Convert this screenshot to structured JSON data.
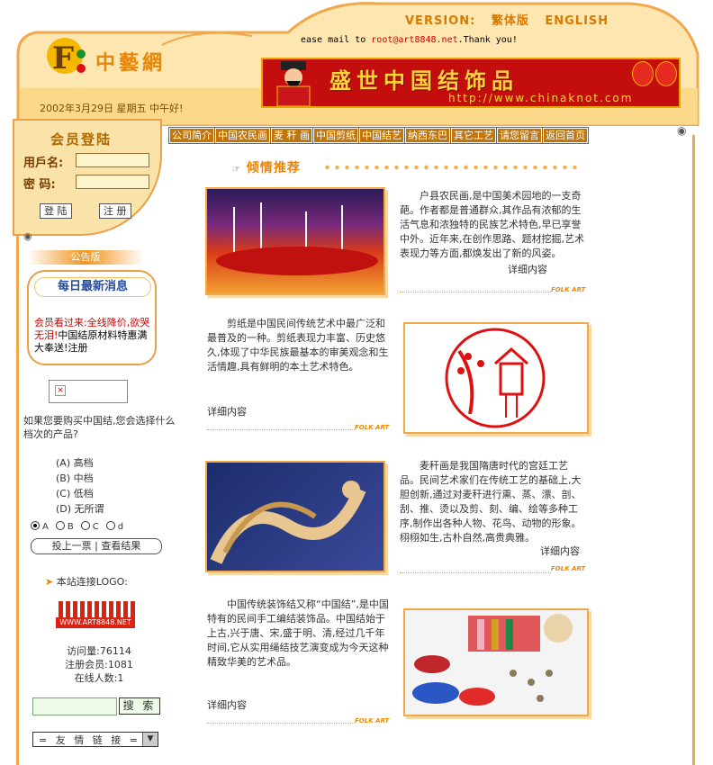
{
  "header": {
    "version_label": "VERSION:",
    "traditional": "繁体版",
    "english": "ENGLISH",
    "scroll_prefix": "ease mail to ",
    "scroll_email": "root@art8848.net",
    "scroll_suffix": ".Thank you!",
    "site_name": "中藝網",
    "date": "2002年3月29日  星期五    中午好!",
    "banner_title": "盛世中国结饰品",
    "banner_url": "http://www.chinaknot.com"
  },
  "nav": [
    "公司简介",
    "中国农民画",
    "麦 秆 画",
    "中国剪纸",
    "中国结艺",
    "纳西东巴",
    "其它工艺",
    "请您留言",
    "返回首页"
  ],
  "login": {
    "title": "会员登陆",
    "user_label": "用戶名:",
    "pass_label": "密  码:",
    "login_btn": "登 陆",
    "register_btn": "注 册"
  },
  "notice": {
    "tab": "公告版",
    "heading": "每日最新消息",
    "text_red": "会员看过来:全线降价,欲哭无泪!",
    "text_black": "中国结原材料特惠满大奉送!注册"
  },
  "poll": {
    "question": "如果您要购买中国结,您会选择什么档次的产品?",
    "options": [
      "(A) 高档",
      "(B) 中档",
      "(C) 低档",
      "(D) 无所谓"
    ],
    "radios": [
      "A",
      "B",
      "C",
      "d"
    ],
    "vote_label": "投上一票 | 查看结果"
  },
  "sidebar": {
    "link_logo": "本站连接LOGO:",
    "logo_text": "WWW.ART8848.NET",
    "visits": "访问量:76114",
    "members": "注册会员:1081",
    "online": "在线人数:1",
    "search_btn": "搜 索",
    "friend_links": "= 友 情 链 接 ="
  },
  "main": {
    "heading": "倾情推荐",
    "folk_art": "FOLK ART",
    "detail": "详细内容",
    "items": [
      {
        "text": "户县农民画,是中国美术园地的一支奇葩。作者都是普通群众,其作品有浓郁的生活气息和浓独特的民族艺术特色,早已享誉中外。近年来,在创作思路、题材挖掘,艺术表现力等方面,都焕发出了新的风姿。"
      },
      {
        "text": "剪纸是中国民间传统艺术中最广泛和最普及的一种。剪纸表现力丰富、历史悠久,体现了中华民族最基本的审美观念和生活情趣,具有鲜明的本土艺术特色。"
      },
      {
        "text": "麦秆画是我国隋唐时代的宫廷工艺品。民间艺术家们在传统工艺的基础上,大胆创新,通过对麦秆进行熏、蒸、漂、剖、刮、推、烫以及剪、刻、编、绘等多种工序,制作出各种人物、花鸟、动物的形象。栩栩如生,古朴自然,高贵典雅。"
      },
      {
        "text": "中国传统装饰结又称“中国结”,是中国特有的民间手工编结装饰品。中国结始于上古,兴于唐、宋,盛于明、清,经过几千年时间,它从实用绳结技艺演变成为今天这种精致华美的艺术品。"
      }
    ]
  }
}
